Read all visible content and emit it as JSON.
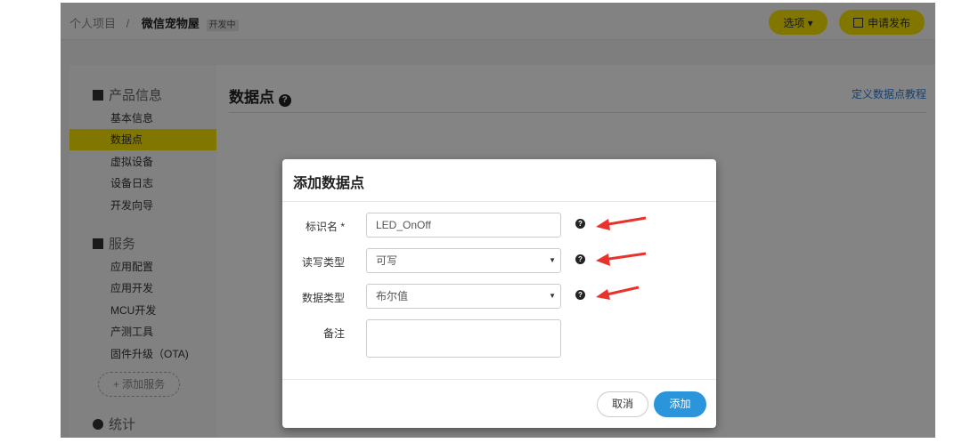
{
  "header": {
    "breadcrumb_root": "个人项目",
    "separator": "/",
    "project": "微信宠物屋",
    "status": "开发中",
    "options_btn": "选项 ▾",
    "publish_btn": "申请发布"
  },
  "sidebar": {
    "section_product": "产品信息",
    "product_items": [
      "基本信息",
      "数据点",
      "虚拟设备",
      "设备日志",
      "开发向导"
    ],
    "section_service": "服务",
    "service_items": [
      "应用配置",
      "应用开发",
      "MCU开发",
      "产测工具",
      "固件升级（OTA)"
    ],
    "add_service": "+ 添加服务",
    "section_stats": "统计"
  },
  "main": {
    "title": "数据点",
    "help": "?",
    "tutorial_link": "定义数据点教程"
  },
  "modal": {
    "title": "添加数据点",
    "fields": [
      {
        "label": "标识名 *",
        "value": "LED_OnOff"
      },
      {
        "label": "读写类型",
        "value": "可写"
      },
      {
        "label": "数据类型",
        "value": "布尔值"
      },
      {
        "label": "备注",
        "value": ""
      }
    ],
    "help": "?",
    "cancel": "取消",
    "submit": "添加"
  },
  "colors": {
    "accent": "#f7e300",
    "primary": "#2b95dc",
    "arrow": "#e8322b"
  }
}
